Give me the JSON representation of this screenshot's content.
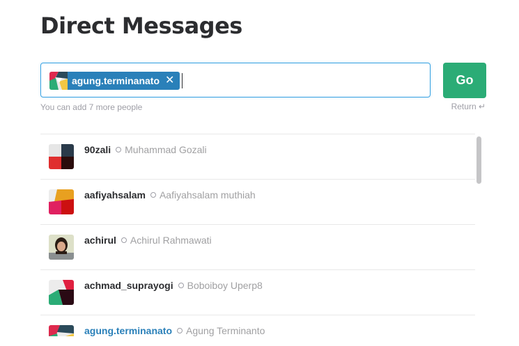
{
  "page": {
    "title": "Direct Messages"
  },
  "recipient_input": {
    "token": {
      "label": "agung.terminanato",
      "remove_symbol": "✕"
    },
    "hint": "You can add 7 more people"
  },
  "go_button": {
    "label": "Go"
  },
  "return_hint": "Return ↵",
  "colors": {
    "accent": "#2a80b9",
    "go": "#2bac76",
    "border": "#3aa3e3"
  },
  "users": [
    {
      "username": "90zali",
      "real_name": "Muhammad Gozali",
      "avatar": "geo-avatar-1"
    },
    {
      "username": "aafiyahsalam",
      "real_name": "Aafiyahsalam muthiah",
      "avatar": "geo-avatar-2"
    },
    {
      "username": "achirul",
      "real_name": "Achirul Rahmawati",
      "avatar": "photo-avatar"
    },
    {
      "username": "achmad_suprayogi",
      "real_name": "Boboiboy Uperp8",
      "avatar": "geo-avatar-3"
    },
    {
      "username": "agung.terminanato",
      "real_name": "Agung Terminanto",
      "avatar": "geo-avatar-4"
    }
  ]
}
